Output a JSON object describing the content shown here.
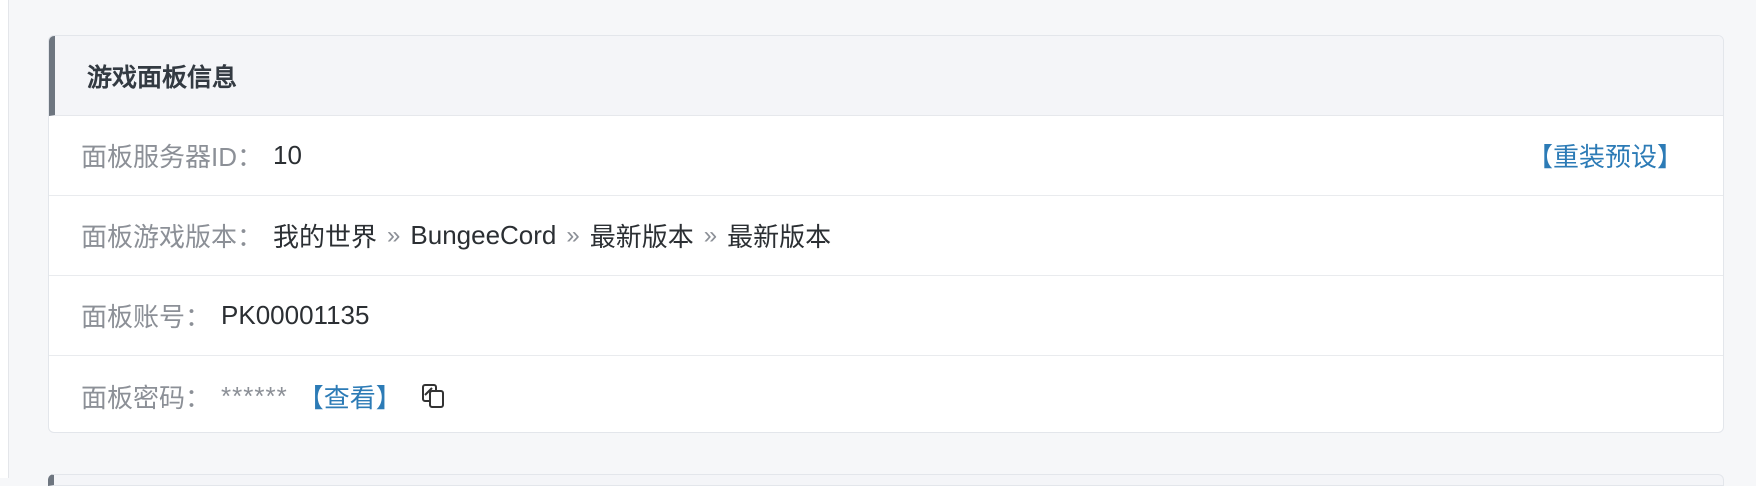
{
  "panel": {
    "title": "游戏面板信息",
    "server_id": {
      "label": "面板服务器ID：",
      "value": "10",
      "action": "【重装预设】"
    },
    "game_version": {
      "label": "面板游戏版本：",
      "parts": [
        "我的世界",
        "BungeeCord",
        "最新版本",
        "最新版本"
      ],
      "separator": "»"
    },
    "account": {
      "label": "面板账号：",
      "value": "PK00001135"
    },
    "password": {
      "label": "面板密码：",
      "masked": "******",
      "action": "【查看】",
      "copy_icon": "copy-icon"
    }
  },
  "colors": {
    "accent_link": "#2c7bb6",
    "header_bar": "#6e7680",
    "label": "#8c9097"
  }
}
